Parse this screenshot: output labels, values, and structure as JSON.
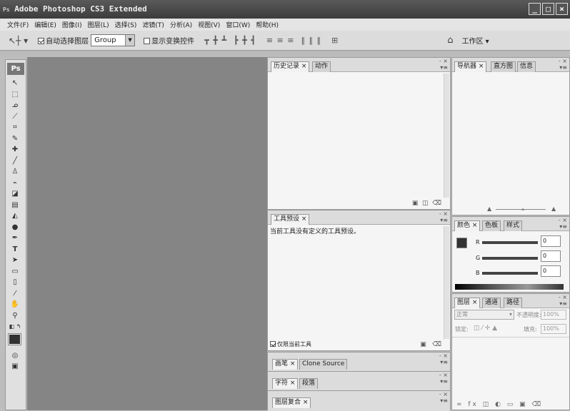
{
  "titlebar": {
    "title": "Adobe Photoshop CS3 Extended",
    "logo": "Ps",
    "buttons": [
      "_",
      "□",
      "×"
    ]
  },
  "menu": [
    "文件(F)",
    "编辑(E)",
    "图像(I)",
    "图层(L)",
    "选择(S)",
    "滤镜(T)",
    "分析(A)",
    "视图(V)",
    "窗口(W)",
    "帮助(H)"
  ],
  "options": {
    "auto_select_label": "自动选择图层",
    "auto_select_checked": true,
    "group_value": "Group",
    "show_transform_label": "显示变换控件",
    "show_transform_checked": false,
    "workspace_label": "工作区 ▾"
  },
  "toolbox": {
    "logo": "Ps",
    "tools": [
      "move",
      "marquee",
      "lasso",
      "magic-wand",
      "crop",
      "slice",
      "healing-brush",
      "brush",
      "clone-stamp",
      "history-brush",
      "eraser",
      "gradient",
      "blur",
      "dodge",
      "pen",
      "type",
      "path-selection",
      "shape",
      "notes",
      "eyedropper",
      "hand",
      "zoom"
    ]
  },
  "panels": {
    "history": {
      "tabs": [
        "历史记录",
        "动作"
      ]
    },
    "navigator": {
      "tabs": [
        "导航器",
        "直方图",
        "信息"
      ]
    },
    "tool_presets": {
      "tabs": [
        "工具预设"
      ],
      "message": "当前工具没有定义的工具预设。",
      "checkbox_label": "仅限当前工具"
    },
    "brushes": {
      "tabs": [
        "画笔",
        "Clone Source"
      ]
    },
    "character": {
      "tabs": [
        "字符",
        "段落"
      ]
    },
    "layer_comps": {
      "tabs": [
        "图层复合"
      ]
    },
    "color": {
      "tabs": [
        "颜色",
        "色板",
        "样式"
      ],
      "channels": [
        {
          "name": "R",
          "value": "0"
        },
        {
          "name": "G",
          "value": "0"
        },
        {
          "name": "B",
          "value": "0"
        }
      ]
    },
    "layers": {
      "tabs": [
        "图层",
        "通道",
        "路径"
      ],
      "blend_mode": "正常",
      "opacity_label": "不透明度:",
      "opacity_value": "100%",
      "lock_label": "锁定:",
      "fill_label": "填充:",
      "fill_value": "100%"
    }
  },
  "colors": {
    "canvas": "#858585",
    "panel": "#f5f5f5",
    "titlebar": "#4a4a4a",
    "foreground_swatch": "#333333"
  }
}
